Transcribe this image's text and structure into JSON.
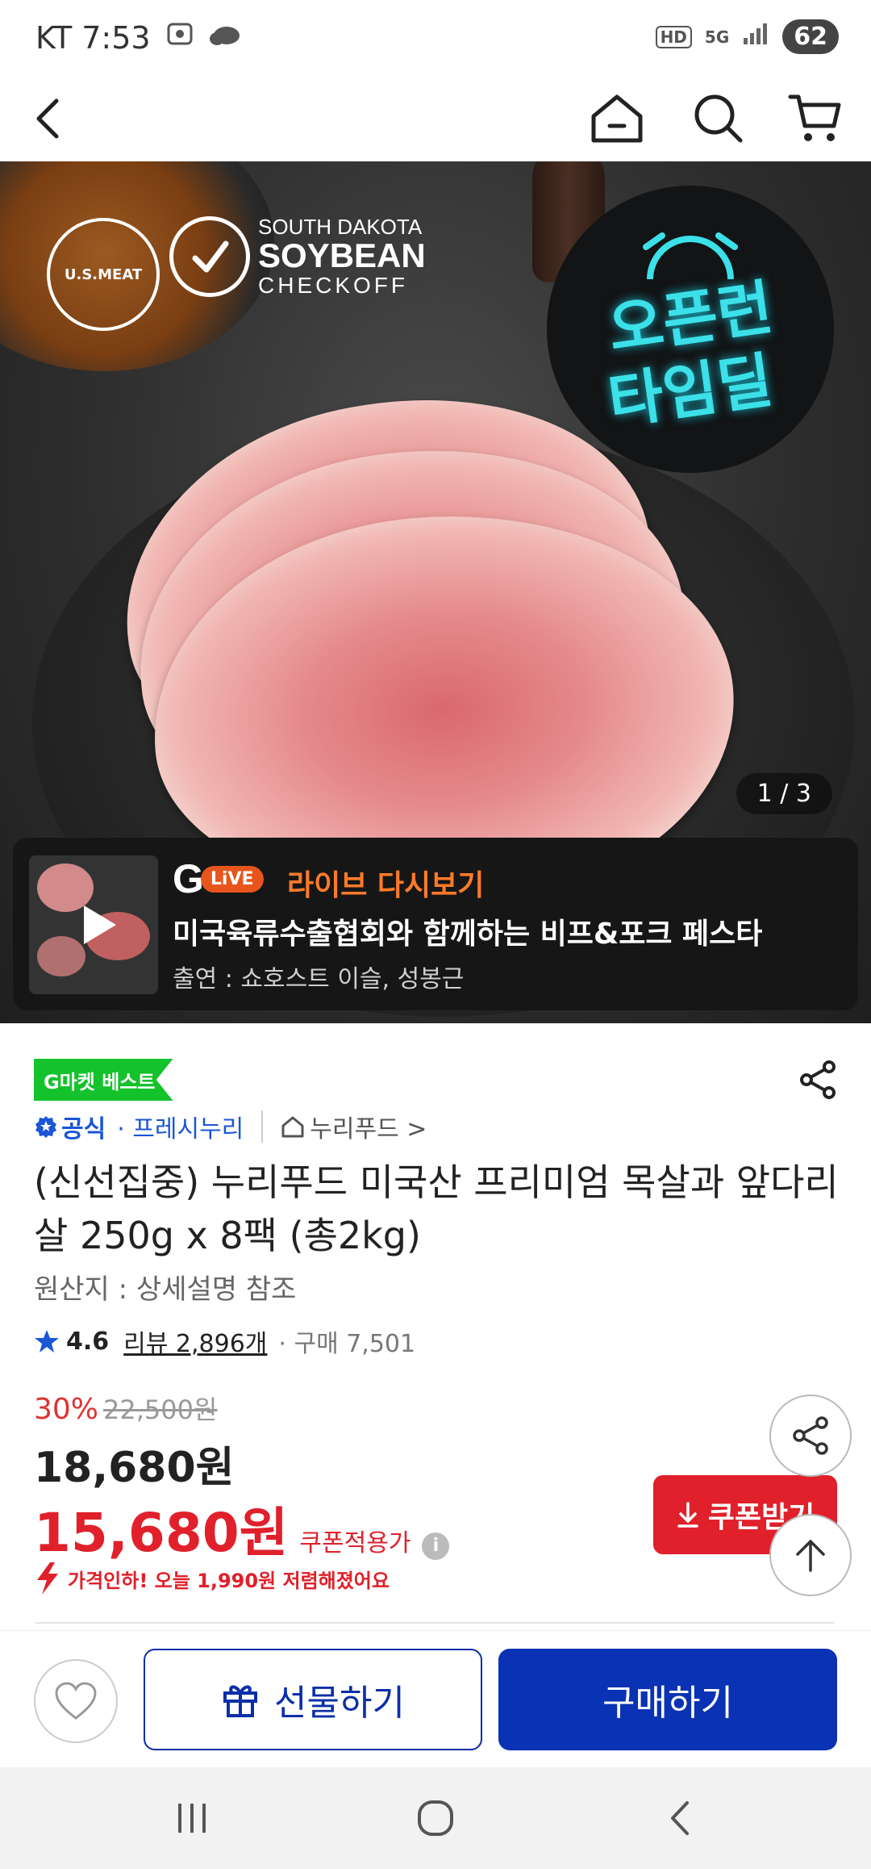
{
  "status_bar": {
    "carrier_time": "KT 7:53",
    "hd": "HD",
    "network": "5G",
    "battery": "62"
  },
  "hero": {
    "logo_meat_text": "U.S.MEAT",
    "logo_soy_line1": "SOUTH DAKOTA",
    "logo_soy_line2": "SOYBEAN",
    "logo_soy_line3": "CHECKOFF",
    "badge_line1": "오픈런",
    "badge_line2": "타임딜",
    "page_counter": "1 / 3"
  },
  "live": {
    "g_letter": "G",
    "live_pill": "LiVE",
    "replay_label": "라이브 다시보기",
    "title": "미국육류수출협회와 함께하는 비프&포크 페스타",
    "cast": "출연 : 쇼호스트 이슬, 성봉근"
  },
  "product": {
    "best_badge": "G마켓 베스트",
    "official_label": "공식",
    "store_name": "· 프레시누리",
    "brand_name": "누리푸드 >",
    "title": "(신선집중) 누리푸드 미국산 프리미엄 목살과 앞다리살 250g x 8팩 (총2kg)",
    "origin": "원산지 : 상세설명 참조",
    "rating": "4.6",
    "reviews": "리뷰 2,896개",
    "purchases": "· 구매 7,501",
    "discount": "30%",
    "original_price": "22,500원",
    "price": "18,680원",
    "coupon_price": "15,680원",
    "coupon_price_label": "쿠폰적용가",
    "price_drop_notice": "가격인하! 오늘 1,990원 저렴해졌어요",
    "coupon_button": "쿠폰받기"
  },
  "actions": {
    "gift": "선물하기",
    "buy": "구매하기"
  },
  "colors": {
    "primary_blue": "#0a32b4",
    "sale_red": "#e0202b",
    "best_green": "#14c22b",
    "live_orange": "#ff7a2a"
  }
}
